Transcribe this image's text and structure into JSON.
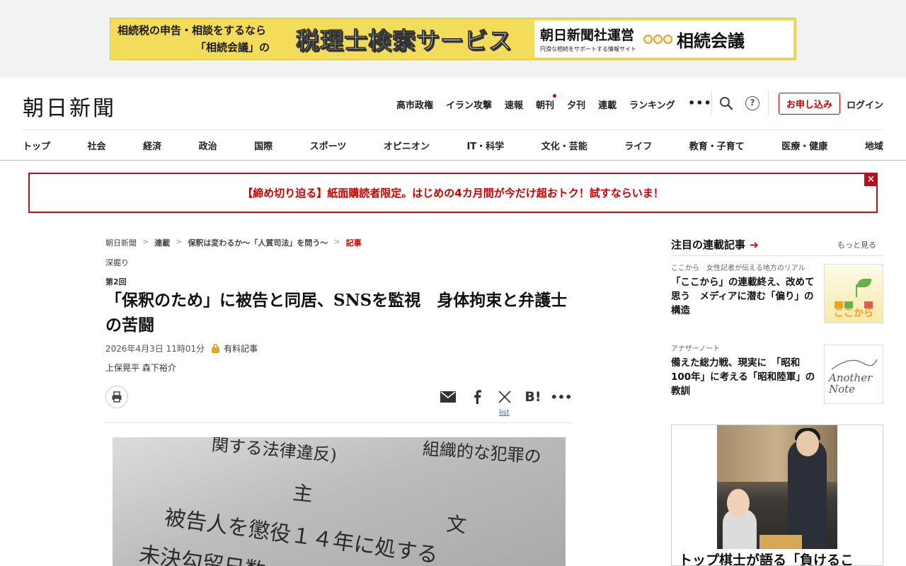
{
  "ad": {
    "left_line1": "相続税の申告・相談をするなら",
    "left_line2": "「相続会議」の",
    "headline": "税理士検索サービス",
    "right_title": "朝日新聞社運営",
    "right_sub": "円滑な相続をサポートする情報サイト",
    "right_logo": "相続会議"
  },
  "header": {
    "logo": "朝日新聞",
    "nav": [
      "高市政権",
      "イラン攻撃",
      "速報",
      "朝刊",
      "夕刊",
      "連載",
      "ランキング"
    ],
    "more": "•••",
    "subscribe": "お申し込み",
    "login": "ログイン"
  },
  "categories": [
    "トップ",
    "社会",
    "経済",
    "政治",
    "国際",
    "スポーツ",
    "オピニオン",
    "IT・科学",
    "文化・芸能",
    "ライフ",
    "教育・子育て",
    "医療・健康",
    "地域"
  ],
  "promo": {
    "text": "【締め切り迫る】紙面購読者限定。はじめの4カ月間が今だけ超おトク！試すならいま！",
    "close": "×"
  },
  "article": {
    "breadcrumb": [
      "朝日新聞",
      "連載",
      "保釈は変わるか～「人質司法」を問う～",
      "記事"
    ],
    "kicker": "深掘り",
    "series_no": "第2回",
    "title": "「保釈のため」に被告と同居、SNSを監視　身体拘束と弁護士の苦闘",
    "date": "2026年4月3日 11時01分",
    "paid_label": "有料記事",
    "authors": "上保晃平 森下裕介",
    "list_link": "list",
    "photo_text": [
      "関する法律違反)",
      "組織的な犯罪の",
      "主",
      "文",
      "被告人を懲役１４年に処する",
      "未決勾留日数"
    ]
  },
  "sidebar": {
    "title": "注目の連載記事",
    "more": "もっと見る",
    "cards": [
      {
        "category": "ここから　女性記者が伝える地方のリアル",
        "title": "「ここから」の連載終え、改めて思う　メディアに潜む「偏り」の構造",
        "thumb_label": "ここから"
      },
      {
        "category": "アナザーノート",
        "title": "備えた総力戦、現実に　「昭和100年」に考える「昭和陸軍」の教訓",
        "thumb_label_1": "Another",
        "thumb_label_2": "Note"
      }
    ],
    "big_card_title": "トップ棋士が語る「負けるこ"
  },
  "colors": {
    "accent": "#c00000",
    "ad_yellow": "#f4dc5b",
    "link": "#1a6fbf"
  }
}
